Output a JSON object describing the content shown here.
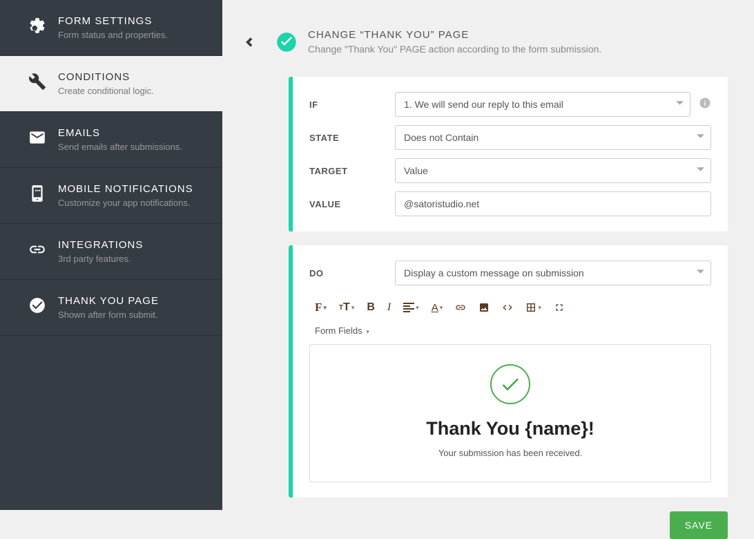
{
  "sidebar": {
    "items": [
      {
        "title": "FORM SETTINGS",
        "sub": "Form status and properties."
      },
      {
        "title": "CONDITIONS",
        "sub": "Create conditional logic."
      },
      {
        "title": "EMAILS",
        "sub": "Send emails after submissions."
      },
      {
        "title": "MOBILE NOTIFICATIONS",
        "sub": "Customize your app notifications."
      },
      {
        "title": "INTEGRATIONS",
        "sub": "3rd party features."
      },
      {
        "title": "THANK YOU PAGE",
        "sub": "Shown after form submit."
      }
    ]
  },
  "header": {
    "title": "CHANGE “THANK YOU” PAGE",
    "sub": "Change \"Thank You\" PAGE action according to the form submission."
  },
  "condition": {
    "labels": {
      "if": "IF",
      "state": "STATE",
      "target": "TARGET",
      "value": "VALUE"
    },
    "if_value": "1. We will send our reply to this email",
    "state_value": "Does not Contain",
    "target_value": "Value",
    "value_input": "@satoristudio.net"
  },
  "action": {
    "label": "DO",
    "do_value": "Display a custom message on submission",
    "form_fields_label": "Form Fields",
    "message_title": "Thank You {name}!",
    "message_body": "Your submission has been received."
  },
  "buttons": {
    "save": "SAVE"
  },
  "colors": {
    "accent": "#1bd4a8",
    "success": "#4aae4e",
    "sidebar_bg": "#363c44"
  }
}
